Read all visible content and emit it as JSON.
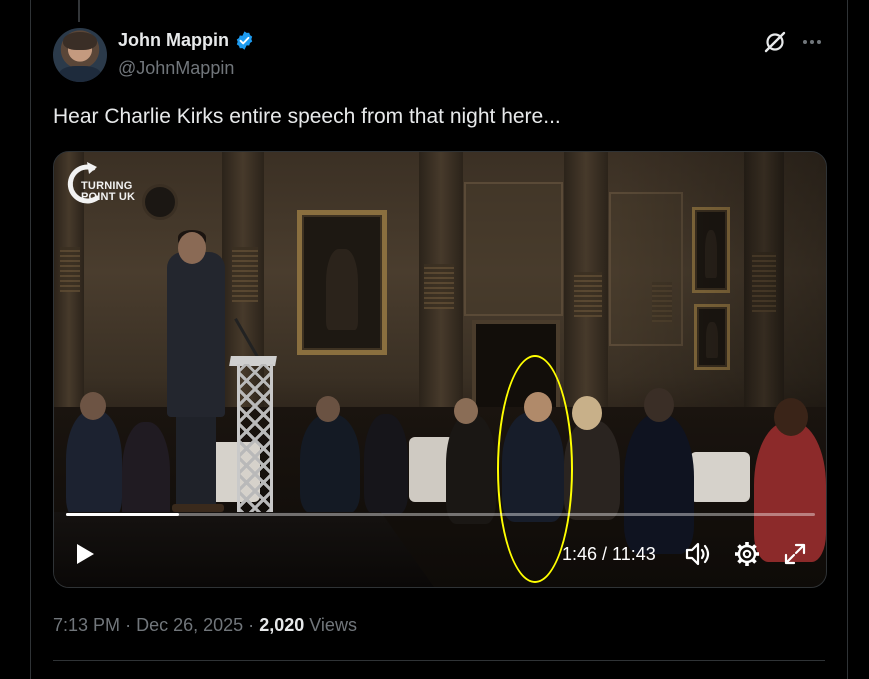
{
  "author": {
    "display_name": "John Mappin",
    "handle": "@JohnMappin",
    "verified": true,
    "verified_color": "#1d9bf0"
  },
  "tweet": {
    "text": "Hear Charlie Kirks entire speech from that night here...",
    "time": "7:13 PM",
    "date": "Dec 26, 2025",
    "separator": "·",
    "views_count": "2,020",
    "views_label": "Views"
  },
  "media": {
    "type": "video",
    "logo_text_line1": "TURNING",
    "logo_text_line2": "POINT UK",
    "current_time": "1:46",
    "duration": "11:43",
    "time_display": "1:46 / 11:43",
    "progress_fraction": 0.151,
    "annotation": "yellow-ellipse-highlight"
  },
  "icons": {
    "grok": "grok-icon",
    "more": "more-icon",
    "play": "play-icon",
    "volume": "volume-icon",
    "settings": "gear-icon",
    "fullscreen": "fullscreen-icon"
  },
  "colors": {
    "background": "#000000",
    "text_primary": "#e7e9ea",
    "text_secondary": "#71767b",
    "border": "#2f3336",
    "highlight": "#ffff00"
  }
}
